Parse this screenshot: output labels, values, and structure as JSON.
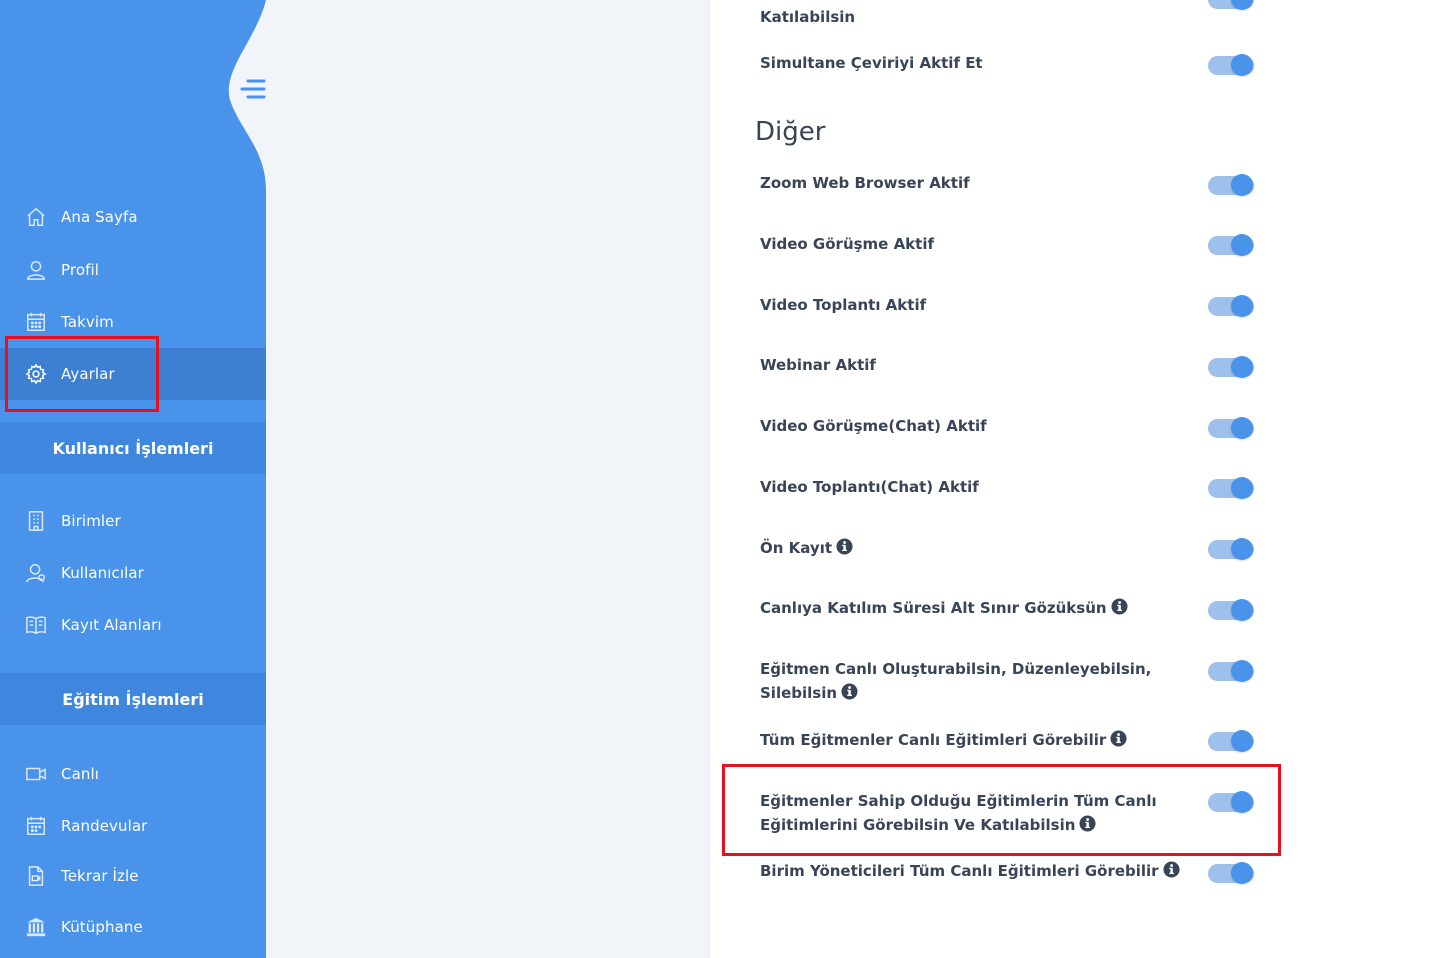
{
  "sidebar": {
    "menu_icon": "menu-toggle-icon",
    "items_top": [
      {
        "label": "Ana Sayfa",
        "icon": "home-icon"
      },
      {
        "label": "Profil",
        "icon": "user-icon"
      },
      {
        "label": "Takvim",
        "icon": "calendar-icon"
      },
      {
        "label": "Ayarlar",
        "icon": "gear-icon",
        "active": true
      }
    ],
    "section_users": "Kullanıcı İşlemleri",
    "items_users": [
      {
        "label": "Birimler",
        "icon": "building-icon"
      },
      {
        "label": "Kullanıcılar",
        "icon": "users-icon"
      },
      {
        "label": "Kayıt Alanları",
        "icon": "book-icon"
      }
    ],
    "section_education": "Eğitim İşlemleri",
    "items_education": [
      {
        "label": "Canlı",
        "icon": "video-camera-icon"
      },
      {
        "label": "Randevular",
        "icon": "calendar-icon"
      },
      {
        "label": "Tekrar İzle",
        "icon": "video-file-icon"
      },
      {
        "label": "Kütüphane",
        "icon": "library-icon"
      }
    ]
  },
  "settings": {
    "partial_top_label": "Katılabilsin",
    "simultane_label": "Simultane Çeviriyi Aktif Et",
    "section_title": "Diğer",
    "items": [
      {
        "label": "Zoom Web Browser Aktif",
        "enabled": true
      },
      {
        "label": "Video Görüşme  Aktif",
        "enabled": true
      },
      {
        "label": "Video Toplantı  Aktif",
        "enabled": true
      },
      {
        "label": "Webinar  Aktif",
        "enabled": true
      },
      {
        "label": "Video Görüşme(Chat) Aktif",
        "enabled": true
      },
      {
        "label": "Video Toplantı(Chat) Aktif",
        "enabled": true
      },
      {
        "label": "Ön Kayıt",
        "enabled": true,
        "info": true
      },
      {
        "label": "Canlıya Katılım Süresi Alt Sınır Gözüksün",
        "enabled": true,
        "info": true
      },
      {
        "label": "Eğitmen Canlı Oluşturabilsin, Düzenleyebilsin, Silebilsin",
        "enabled": true,
        "info": true
      },
      {
        "label": "Tüm Eğitmenler Canlı Eğitimleri Görebilir",
        "enabled": true,
        "info": true
      },
      {
        "label": "Eğitmenler Sahip Olduğu Eğitimlerin Tüm Canlı Eğitimlerini Görebilsin Ve Katılabilsin",
        "enabled": true,
        "info": true
      },
      {
        "label": "Birim Yöneticileri Tüm Canlı Eğitimleri Görebilir",
        "enabled": true,
        "info": true
      }
    ]
  },
  "colors": {
    "sidebar_bg": "#4a93eb",
    "sidebar_active": "#3c7fd3",
    "toggle_on": "#4a93eb",
    "annotation": "#e8101d"
  }
}
